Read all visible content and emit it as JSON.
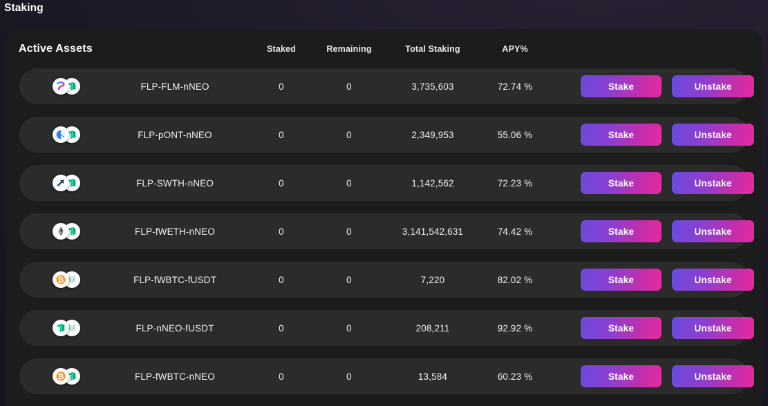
{
  "page": {
    "title": "Staking"
  },
  "card": {
    "title": "Active Assets",
    "columns": {
      "asset": "",
      "staked": "Staked",
      "remaining": "Remaining",
      "total_staking": "Total Staking",
      "apy": "APY%"
    },
    "actions": {
      "stake_label": "Stake",
      "unstake_label": "Unstake"
    },
    "rows": [
      {
        "name": "FLP-FLM-nNEO",
        "staked": "0",
        "remaining": "0",
        "total_staking": "3,735,603",
        "apy": "72.74 %",
        "icon_a": "flm-icon",
        "icon_b": "neo-icon"
      },
      {
        "name": "FLP-pONT-nNEO",
        "staked": "0",
        "remaining": "0",
        "total_staking": "2,349,953",
        "apy": "55.06 %",
        "icon_a": "ont-icon",
        "icon_b": "neo-icon"
      },
      {
        "name": "FLP-SWTH-nNEO",
        "staked": "0",
        "remaining": "0",
        "total_staking": "1,142,562",
        "apy": "72.23 %",
        "icon_a": "swth-icon",
        "icon_b": "neo-icon"
      },
      {
        "name": "FLP-fWETH-nNEO",
        "staked": "0",
        "remaining": "0",
        "total_staking": "3,141,542,631",
        "apy": "74.42 %",
        "icon_a": "eth-icon",
        "icon_b": "neo-icon"
      },
      {
        "name": "FLP-fWBTC-fUSDT",
        "staked": "0",
        "remaining": "0",
        "total_staking": "7,220",
        "apy": "82.02 %",
        "icon_a": "btc-icon",
        "icon_b": "usdt-icon"
      },
      {
        "name": "FLP-nNEO-fUSDT",
        "staked": "0",
        "remaining": "0",
        "total_staking": "208,211",
        "apy": "92.92 %",
        "icon_a": "neo-icon",
        "icon_b": "usdt-icon"
      },
      {
        "name": "FLP-fWBTC-nNEO",
        "staked": "0",
        "remaining": "0",
        "total_staking": "13,584",
        "apy": "60.23 %",
        "icon_a": "btc-icon",
        "icon_b": "neo-icon"
      }
    ]
  },
  "colors": {
    "card_background": "#1c1c1c",
    "row_background": "#2b2b2b",
    "button_gradient_start": "#6a4bde",
    "button_gradient_end": "#e62a9e",
    "neo_green": "#00c88c",
    "btc_orange": "#f7931a",
    "usdt_teal": "#a7d4cb",
    "flm_pink": "#ff2bb0",
    "ont_blue": "#3a7ff0",
    "swth_navy": "#17425f",
    "eth_gray": "#3c3c3d"
  }
}
